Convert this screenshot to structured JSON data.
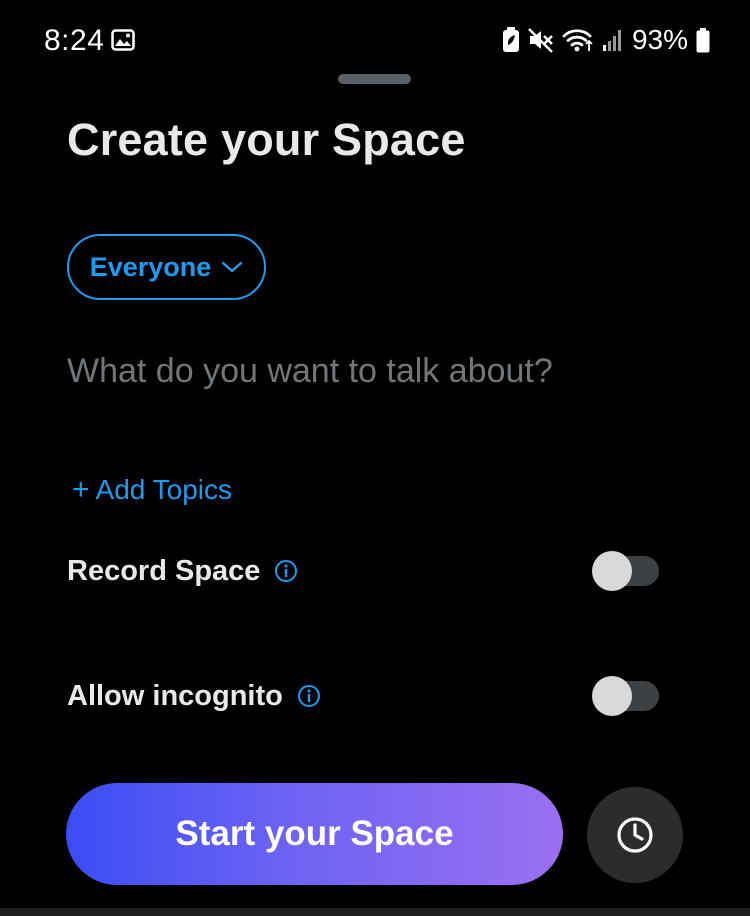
{
  "status_bar": {
    "time": "8:24",
    "battery_percent": "93%",
    "icons": [
      "gallery-icon",
      "battery-saver-icon",
      "mute-icon",
      "wifi-icon",
      "signal-icon",
      "battery-icon"
    ]
  },
  "sheet": {
    "title": "Create your Space",
    "audience_label": "Everyone",
    "topic_placeholder": "What do you want to talk about?",
    "topic_value": "",
    "add_topics_label": "Add Topics",
    "add_topics_icon": "+",
    "toggles": [
      {
        "label": "Record Space",
        "enabled": false
      },
      {
        "label": "Allow incognito",
        "enabled": false
      }
    ],
    "start_button_label": "Start your Space",
    "schedule_icon": "clock-icon"
  },
  "colors": {
    "background": "#000000",
    "accent_blue": "#1d9bf0",
    "placeholder": "#71767b",
    "gradient_start": "#3b4df5",
    "gradient_end": "#9b6ff2"
  }
}
